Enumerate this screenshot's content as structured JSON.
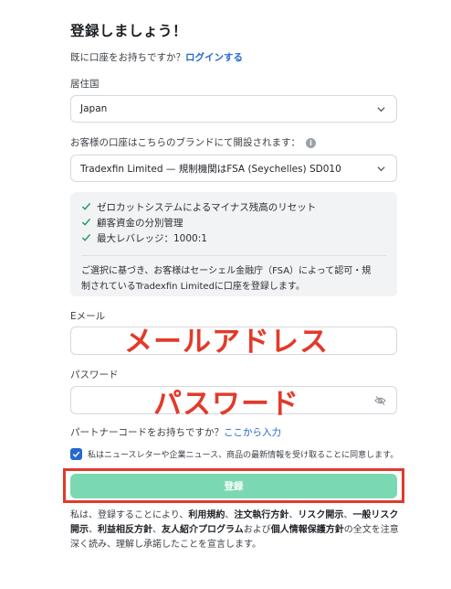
{
  "title": "登録しましょう！",
  "login_prompt": {
    "text": "既に口座をお持ちですか？",
    "link": "ログインする"
  },
  "residence": {
    "label": "居住国",
    "value": "Japan"
  },
  "brand": {
    "label": "お客様の口座はこちらのブランドにて開設されます：",
    "info_icon": "i",
    "value": "Tradexfin Limited — 規制機関はFSA (Seychelles) SD010"
  },
  "benefits": {
    "items": [
      "ゼロカットシステムによるマイナス残高のリセット",
      "顧客資金の分別管理",
      "最大レバレッジ：1000:1"
    ],
    "notice_line1": "ご選択に基づき、お客様はセーシェル金融庁（FSA）によって認可・規",
    "notice_line2": "制されているTradexfin Limitedに口座を登録します。"
  },
  "email": {
    "label": "Eメール",
    "value": "",
    "annotation": "メールアドレス"
  },
  "password": {
    "label": "パスワード",
    "value": "",
    "annotation": "パスワード"
  },
  "partner": {
    "text": "パートナーコードをお持ちですか？",
    "link": "ここから入力"
  },
  "newsletter": {
    "checked": true,
    "text": "私はニュースレターや企業ニュース、商品の最新情報を受け取ることに同意します。"
  },
  "register_button": "登録",
  "terms": {
    "t1": "私は、登録することにより、",
    "l1": "利用規約",
    "s1": "、",
    "l2": "注文執行方針",
    "s2": "、",
    "l3": "リスク開示",
    "s3": "、",
    "l4": "一般リスク開示",
    "s4": "、",
    "l5": "利益相反方針",
    "s5": "、",
    "l6": "友人紹介プログラム",
    "s6": "および",
    "l7": "個人情報保護方針",
    "t2": "の全文を注意深く読み、理解し承諾したことを宣言します。"
  },
  "colors": {
    "link": "#2569d0",
    "register_bg": "#7ad9b3",
    "annotation": "#e23a2b",
    "check": "#1a9c5f"
  },
  "icons": {
    "select_arrow": "chevron-down-icon",
    "info": "info-icon",
    "check": "check-icon",
    "password_toggle": "eye-off-icon"
  }
}
